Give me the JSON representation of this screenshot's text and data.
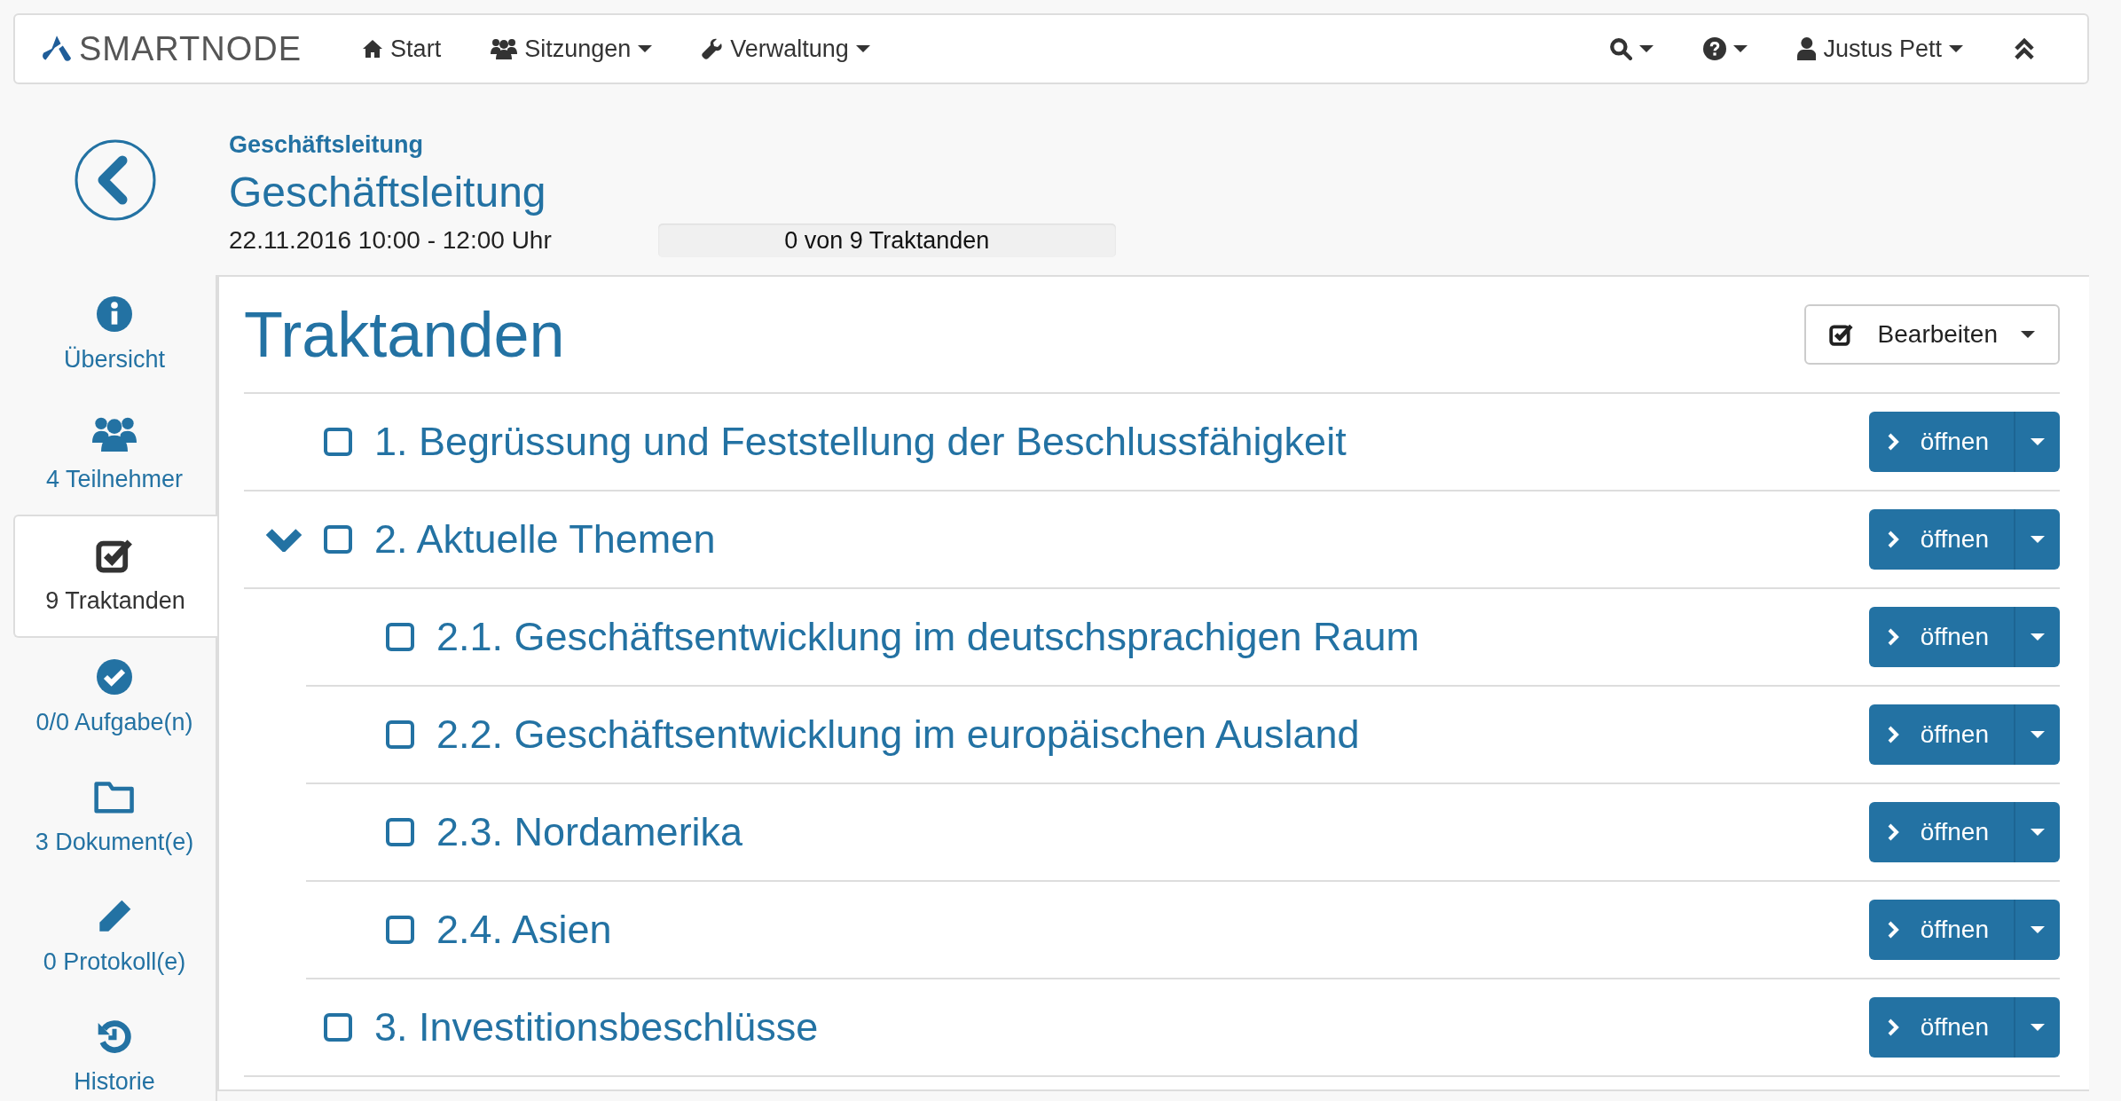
{
  "navbar": {
    "brand": "SMARTNODE",
    "menu": [
      {
        "kind": "home",
        "label": "Start",
        "has_menu": false
      },
      {
        "kind": "users",
        "label": "Sitzungen",
        "has_menu": true
      },
      {
        "kind": "wrench",
        "label": "Verwaltung",
        "has_menu": true
      }
    ],
    "tools": [
      {
        "kind": "search",
        "has_menu": true
      },
      {
        "kind": "help",
        "has_menu": true
      },
      {
        "kind": "user",
        "label": "Justus Pett",
        "has_menu": true
      },
      {
        "kind": "collapse",
        "has_menu": false
      }
    ]
  },
  "sidebar": {
    "items": [
      {
        "kind": "info",
        "label": "Übersicht",
        "selected": false
      },
      {
        "kind": "users",
        "label": "4 Teilnehmer",
        "selected": false
      },
      {
        "kind": "checklist",
        "label": "9 Traktanden",
        "selected": true
      },
      {
        "kind": "task",
        "label": "0/0 Aufgabe(n)",
        "selected": false
      },
      {
        "kind": "folder",
        "label": "3 Dokument(e)",
        "selected": false
      },
      {
        "kind": "pencil",
        "label": "0 Protokoll(e)",
        "selected": false
      },
      {
        "kind": "history",
        "label": "Historie",
        "selected": false
      }
    ]
  },
  "header": {
    "breadcrumb": "Geschäftsleitung",
    "title": "Geschäftsleitung",
    "date": "22.11.2016 10:00 - 12:00 Uhr",
    "progress": {
      "label": "0 von 9 Traktanden",
      "level": 0
    }
  },
  "agenda": {
    "title": "Traktanden",
    "edit_button": "Bearbeiten",
    "items": [
      {
        "title": "1. Begrüssung und Feststellung der Beschlussfähigkeit",
        "checked": false,
        "button": "öffnen"
      },
      {
        "title": "2. Aktuelle Themen",
        "checked": false,
        "button": "öffnen",
        "expanded": true,
        "children": [
          {
            "title": "2.1. Geschäftsentwicklung im deutschsprachigen Raum",
            "checked": false,
            "button": "öffnen"
          },
          {
            "title": "2.2. Geschäftsentwicklung im europäischen Ausland",
            "checked": false,
            "button": "öffnen"
          },
          {
            "title": "2.3. Nordamerika",
            "checked": false,
            "button": "öffnen"
          },
          {
            "title": "2.4. Asien",
            "checked": false,
            "button": "öffnen"
          }
        ]
      },
      {
        "title": "3. Investitionsbeschlüsse",
        "checked": false,
        "button": "öffnen"
      }
    ]
  }
}
